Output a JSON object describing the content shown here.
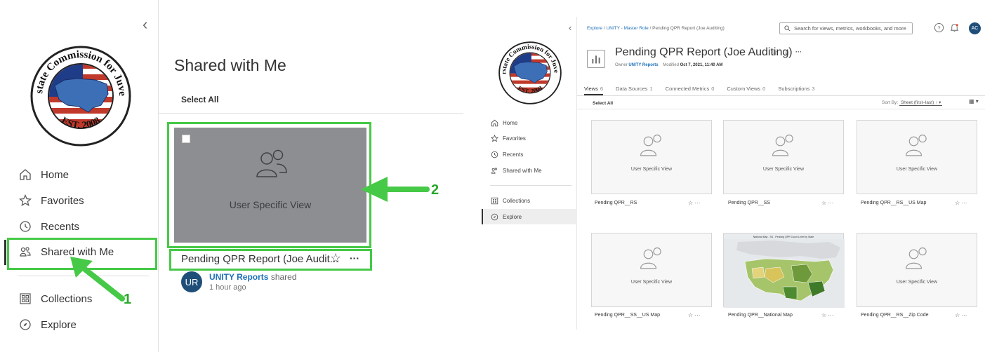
{
  "left": {
    "nav": {
      "items": [
        {
          "label": "Home",
          "icon": "home-icon"
        },
        {
          "label": "Favorites",
          "icon": "star-icon"
        },
        {
          "label": "Recents",
          "icon": "clock-icon"
        },
        {
          "label": "Shared with Me",
          "icon": "shared-users-icon"
        },
        {
          "label": "Collections",
          "icon": "collections-icon"
        },
        {
          "label": "Explore",
          "icon": "explore-icon"
        }
      ]
    },
    "page_title": "Shared with Me",
    "select_all": "Select All",
    "card": {
      "thumb_label": "User Specific View",
      "title": "Pending QPR Report (Joe Audit...",
      "avatar_initials": "UR",
      "sharer": "UNITY Reports",
      "shared_word": "shared",
      "time": "1 hour ago"
    },
    "callouts": {
      "one": "1",
      "two": "2"
    },
    "highlight_color": "#46c947"
  },
  "right": {
    "breadcrumb": {
      "part1": "Explore",
      "sep": "/",
      "part2": "UNITY - Master Role",
      "part3": "Pending QPR Report (Joe Auditing)"
    },
    "search_placeholder": "Search for views, metrics, workbooks, and more",
    "user_initials": "AC",
    "workbook": {
      "title": "Pending QPR Report (Joe Auditing)",
      "owner_label": "Owner",
      "owner": "UNITY Reports",
      "modified_label": "Modified",
      "modified": "Oct 7, 2021, 11:40 AM"
    },
    "tabs": [
      {
        "label": "Views",
        "count": "6"
      },
      {
        "label": "Data Sources",
        "count": "1"
      },
      {
        "label": "Connected Metrics",
        "count": "0"
      },
      {
        "label": "Custom Views",
        "count": "0"
      },
      {
        "label": "Subscriptions",
        "count": "3"
      }
    ],
    "select_all": "Select All",
    "sort_label": "Sort By:",
    "sort_value": "Sheet (first–last)",
    "nav": {
      "items": [
        {
          "label": "Home"
        },
        {
          "label": "Favorites"
        },
        {
          "label": "Recents"
        },
        {
          "label": "Shared with Me"
        },
        {
          "label": "Collections"
        },
        {
          "label": "Explore"
        }
      ]
    },
    "views": [
      {
        "label": "Pending QPR__RS",
        "thumb": "User Specific View"
      },
      {
        "label": "Pending QPR__SS",
        "thumb": "User Specific View"
      },
      {
        "label": "Pending QPR__RS__US Map",
        "thumb": "User Specific View"
      },
      {
        "label": "Pending QPR__SS__US Map",
        "thumb": "User Specific View"
      },
      {
        "label": "Pending QPR__National Map",
        "thumb": "National Map - SS - Pending QPR Count Level by State"
      },
      {
        "label": "Pending QPR__RS__Zip Code",
        "thumb": "User Specific View"
      }
    ]
  }
}
